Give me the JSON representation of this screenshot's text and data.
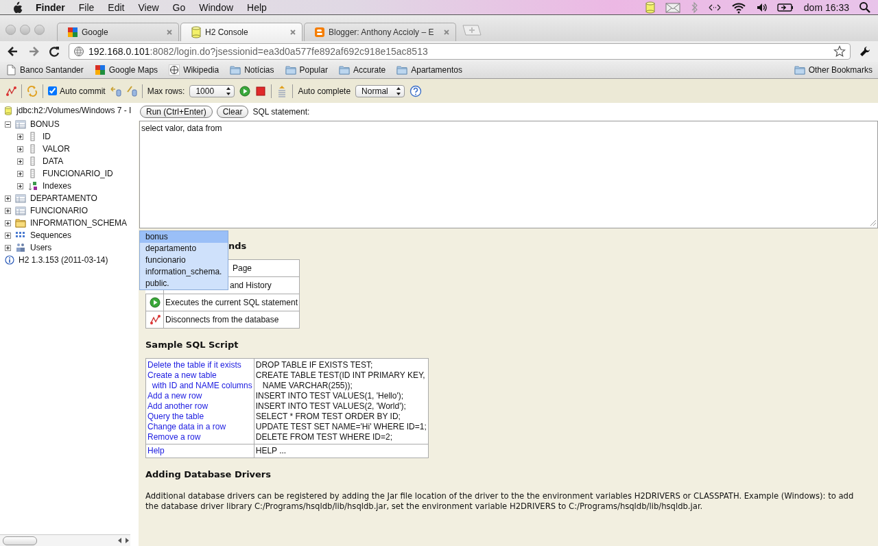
{
  "menubar": {
    "app": "Finder",
    "menus": [
      "File",
      "Edit",
      "View",
      "Go",
      "Window",
      "Help"
    ],
    "clock": "dom 16:33"
  },
  "tabs": [
    {
      "title": "Google",
      "kind": "google",
      "selected": false
    },
    {
      "title": "H2 Console",
      "kind": "database",
      "selected": true
    },
    {
      "title": "Blogger: Anthony Accioly – E",
      "kind": "blogger",
      "selected": false
    }
  ],
  "address": {
    "host": "192.168.0.101",
    "path": ":8082/login.do?jsessionid=ea3d0a577fe892af692c918e15ac8513"
  },
  "bookmarks": [
    {
      "label": "Banco Santander",
      "kind": "page"
    },
    {
      "label": "Google Maps",
      "kind": "google"
    },
    {
      "label": "Wikipedia",
      "kind": "wiki"
    },
    {
      "label": "Notícias",
      "kind": "folder"
    },
    {
      "label": "Popular",
      "kind": "folder"
    },
    {
      "label": "Accurate",
      "kind": "folder"
    },
    {
      "label": "Apartamentos",
      "kind": "folder"
    }
  ],
  "other_bookmarks": "Other Bookmarks",
  "toolbar": {
    "auto_commit": {
      "label": "Auto commit",
      "checked": true
    },
    "max_rows": {
      "label": "Max rows:",
      "value": "1000"
    },
    "auto_complete": {
      "label": "Auto complete",
      "value": "Normal"
    }
  },
  "connection": "jdbc:h2:/Volumes/Windows 7 - I",
  "tree": [
    {
      "label": "BONUS",
      "kind": "table",
      "expanded": true,
      "children": [
        {
          "label": "ID",
          "kind": "column",
          "expanded": false
        },
        {
          "label": "VALOR",
          "kind": "column",
          "expanded": false
        },
        {
          "label": "DATA",
          "kind": "column",
          "expanded": false
        },
        {
          "label": "FUNCIONARIO_ID",
          "kind": "column",
          "expanded": false
        },
        {
          "label": "Indexes",
          "kind": "index",
          "expanded": false
        }
      ]
    },
    {
      "label": "DEPARTAMENTO",
      "kind": "table",
      "expanded": false
    },
    {
      "label": "FUNCIONARIO",
      "kind": "table",
      "expanded": false
    },
    {
      "label": "INFORMATION_SCHEMA",
      "kind": "folder",
      "expanded": false
    },
    {
      "label": "Sequences",
      "kind": "sequence",
      "expanded": false
    },
    {
      "label": "Users",
      "kind": "users",
      "expanded": false
    }
  ],
  "version": "H2 1.3.153 (2011-03-14)",
  "editor": {
    "run": "Run (Ctrl+Enter)",
    "clear": "Clear",
    "label": "SQL statement:",
    "value": "select valor, data from"
  },
  "autocomplete": [
    {
      "text": "bonus",
      "selected": true
    },
    {
      "text": "departamento",
      "selected": false
    },
    {
      "text": "funcionario",
      "selected": false
    },
    {
      "text": "information_schema.",
      "selected": false
    },
    {
      "text": "public.",
      "selected": false
    }
  ],
  "commands": {
    "heading": "nds",
    "rows": [
      {
        "kind": "covered",
        "text": "Page"
      },
      {
        "kind": "covered",
        "text": "and History"
      },
      {
        "kind": "run",
        "text": "Executes the current SQL statement"
      },
      {
        "kind": "disconnect",
        "text": "Disconnects from the database"
      }
    ]
  },
  "sample": {
    "heading": "Sample SQL Script",
    "groups": [
      {
        "items": [
          {
            "action": "Delete the table if it exists",
            "sql": "DROP TABLE IF EXISTS TEST;"
          },
          {
            "action": "Create a new table\n  with ID and NAME columns",
            "sql": "CREATE TABLE TEST(ID INT PRIMARY KEY,\n   NAME VARCHAR(255));"
          },
          {
            "action": "Add a new row",
            "sql": "INSERT INTO TEST VALUES(1, 'Hello');"
          },
          {
            "action": "Add another row",
            "sql": "INSERT INTO TEST VALUES(2, 'World');"
          },
          {
            "action": "Query the table",
            "sql": "SELECT * FROM TEST ORDER BY ID;"
          },
          {
            "action": "Change data in a row",
            "sql": "UPDATE TEST SET NAME='Hi' WHERE ID=1;"
          },
          {
            "action": "Remove a row",
            "sql": "DELETE FROM TEST WHERE ID=2;"
          }
        ]
      },
      {
        "items": [
          {
            "action": "Help",
            "sql": "HELP ..."
          }
        ]
      }
    ]
  },
  "drivers": {
    "heading": "Adding Database Drivers",
    "text": "Additional database drivers can be registered by adding the Jar file location of the driver to the the environment variables H2DRIVERS or CLASSPATH. Example (Windows): to add the database driver library C:/Programs/hsqldb/lib/hsqldb.jar, set the environment variable H2DRIVERS to C:/Programs/hsqldb/lib/hsqldb.jar."
  }
}
